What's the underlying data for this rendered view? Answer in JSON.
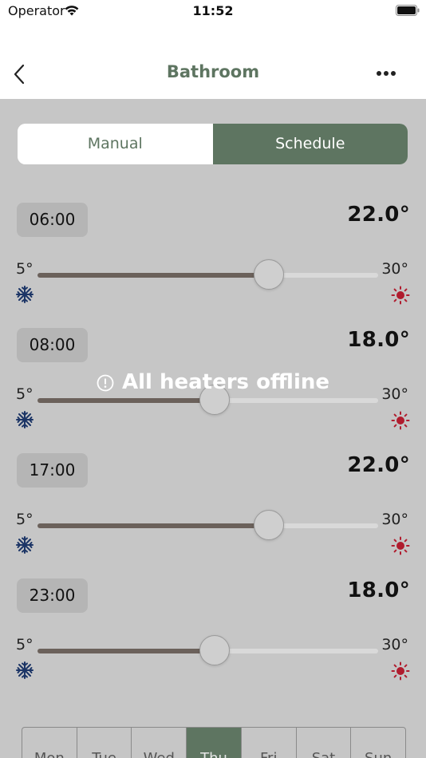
{
  "status_bar": {
    "carrier": "Operator",
    "time": "11:52"
  },
  "nav": {
    "title": "Bathroom",
    "back_icon": "chevron-left-icon",
    "more_icon": "ellipsis-icon"
  },
  "colors": {
    "accent": "#5e7561",
    "background": "#c6c6c6",
    "snow": "#1c3566",
    "sun": "#b01c2e"
  },
  "mode_switch": {
    "manual_label": "Manual",
    "schedule_label": "Schedule",
    "selected": "Schedule"
  },
  "schedule": [
    {
      "time": "06:00",
      "temperature": "22.0°",
      "min_label": "5°",
      "max_label": "30°",
      "value": 22.0
    },
    {
      "time": "08:00",
      "temperature": "18.0°",
      "min_label": "5°",
      "max_label": "30°",
      "value": 18.0
    },
    {
      "time": "17:00",
      "temperature": "22.0°",
      "min_label": "5°",
      "max_label": "30°",
      "value": 22.0
    },
    {
      "time": "23:00",
      "temperature": "18.0°",
      "min_label": "5°",
      "max_label": "30°",
      "value": 18.0
    }
  ],
  "slider_range": {
    "min": 5,
    "max": 30
  },
  "overlay": {
    "message": "All heaters offline"
  },
  "days": {
    "labels": [
      "Mon",
      "Tue",
      "Wed",
      "Thu",
      "Fri",
      "Sat",
      "Sun"
    ],
    "selected": "Thu"
  }
}
